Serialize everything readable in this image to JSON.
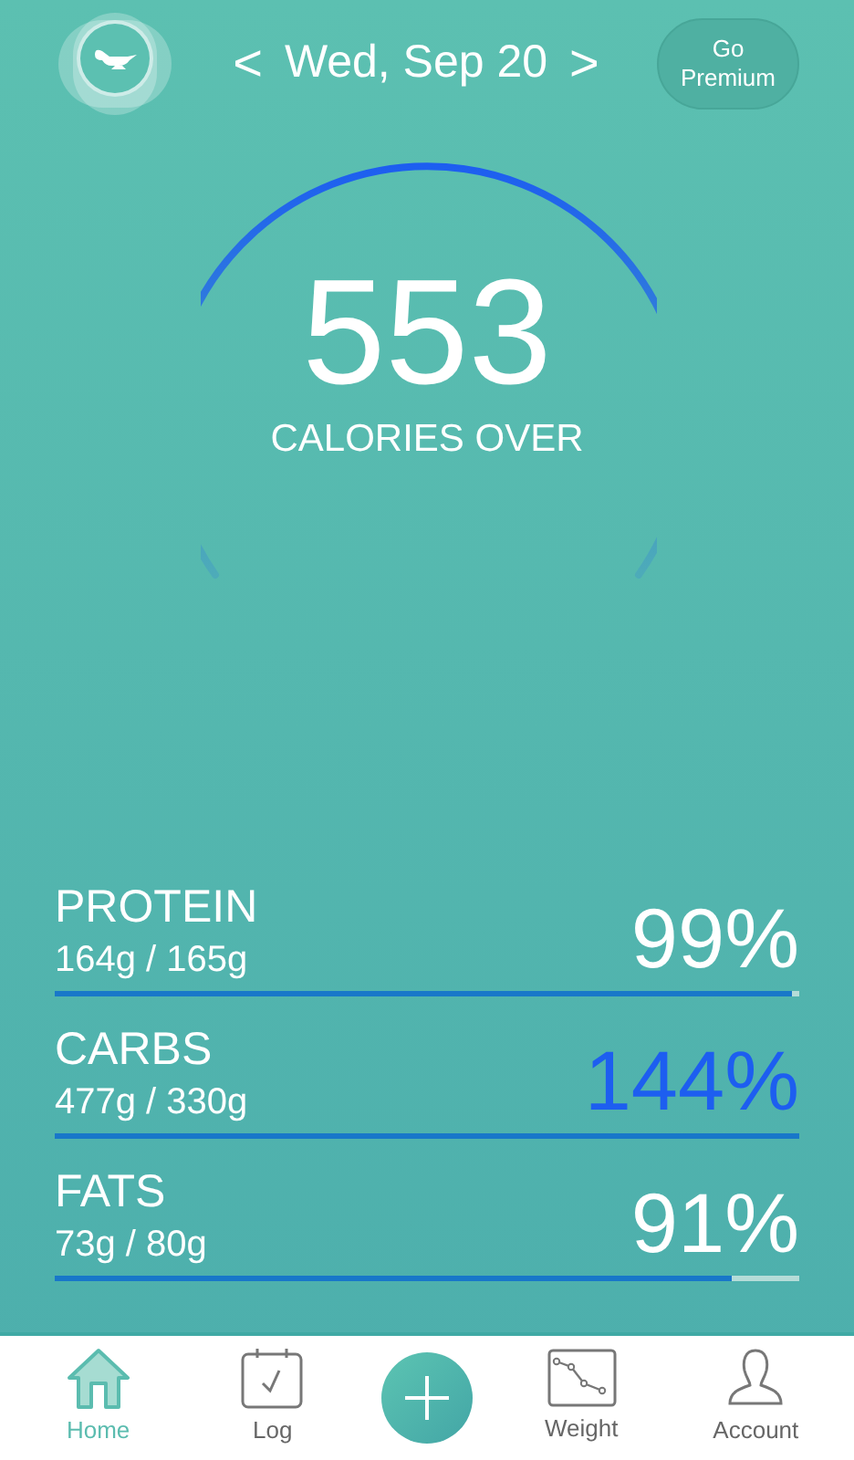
{
  "header": {
    "date": "Wed, Sep 20",
    "prev": "<",
    "next": ">",
    "premium_button": "Go Premium"
  },
  "summary": {
    "value": "553",
    "label": "CALORIES OVER"
  },
  "macros": [
    {
      "name": "PROTEIN",
      "amounts": "164g / 165g",
      "percent": "99%",
      "over": false,
      "level": 0.99
    },
    {
      "name": "CARBS",
      "amounts": "477g / 330g",
      "percent": "144%",
      "over": true,
      "level": 1
    },
    {
      "name": "FATS",
      "amounts": "73g / 80g",
      "percent": "91%",
      "over": false,
      "level": 0.91
    }
  ],
  "nav": [
    {
      "kind": "tab",
      "label": "Home",
      "selected": true
    },
    {
      "kind": "tab",
      "label": "Log",
      "selected": false
    },
    {
      "kind": "add"
    },
    {
      "kind": "tab",
      "label": "Weight",
      "selected": false
    },
    {
      "kind": "tab",
      "label": "Account",
      "selected": false
    }
  ]
}
